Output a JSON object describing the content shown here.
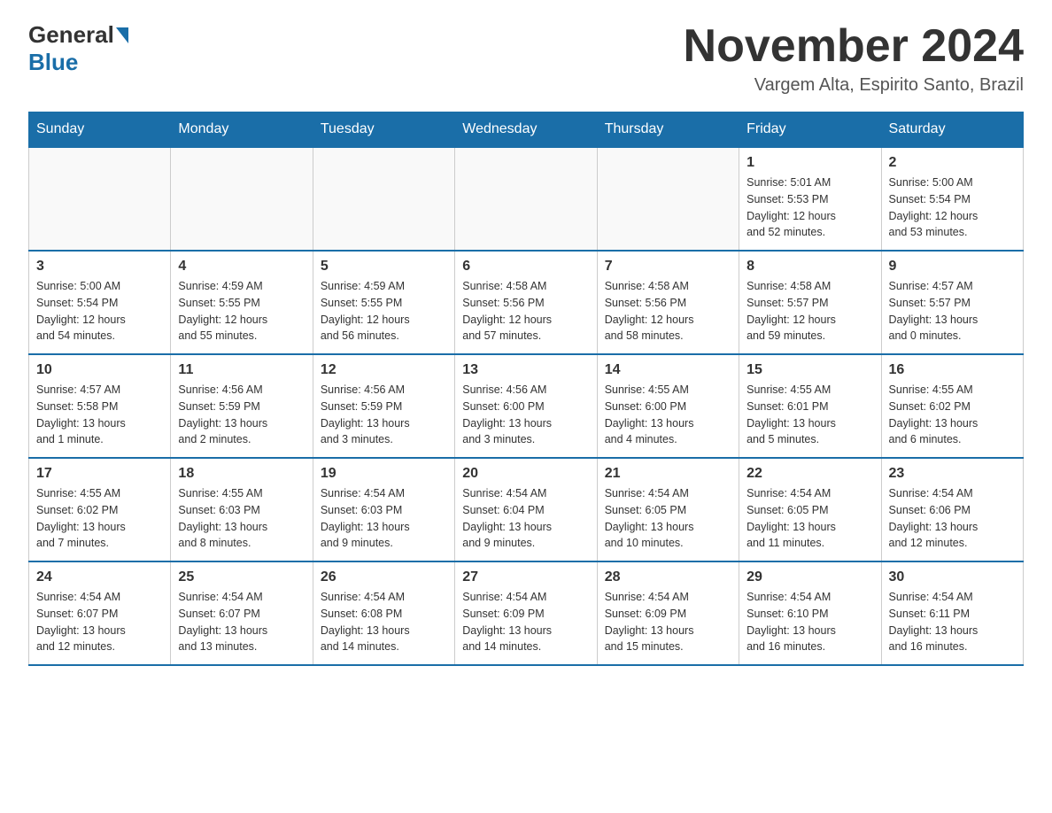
{
  "logo": {
    "general": "General",
    "blue": "Blue"
  },
  "header": {
    "month_year": "November 2024",
    "location": "Vargem Alta, Espirito Santo, Brazil"
  },
  "weekdays": [
    "Sunday",
    "Monday",
    "Tuesday",
    "Wednesday",
    "Thursday",
    "Friday",
    "Saturday"
  ],
  "weeks": [
    [
      {
        "day": "",
        "info": ""
      },
      {
        "day": "",
        "info": ""
      },
      {
        "day": "",
        "info": ""
      },
      {
        "day": "",
        "info": ""
      },
      {
        "day": "",
        "info": ""
      },
      {
        "day": "1",
        "info": "Sunrise: 5:01 AM\nSunset: 5:53 PM\nDaylight: 12 hours\nand 52 minutes."
      },
      {
        "day": "2",
        "info": "Sunrise: 5:00 AM\nSunset: 5:54 PM\nDaylight: 12 hours\nand 53 minutes."
      }
    ],
    [
      {
        "day": "3",
        "info": "Sunrise: 5:00 AM\nSunset: 5:54 PM\nDaylight: 12 hours\nand 54 minutes."
      },
      {
        "day": "4",
        "info": "Sunrise: 4:59 AM\nSunset: 5:55 PM\nDaylight: 12 hours\nand 55 minutes."
      },
      {
        "day": "5",
        "info": "Sunrise: 4:59 AM\nSunset: 5:55 PM\nDaylight: 12 hours\nand 56 minutes."
      },
      {
        "day": "6",
        "info": "Sunrise: 4:58 AM\nSunset: 5:56 PM\nDaylight: 12 hours\nand 57 minutes."
      },
      {
        "day": "7",
        "info": "Sunrise: 4:58 AM\nSunset: 5:56 PM\nDaylight: 12 hours\nand 58 minutes."
      },
      {
        "day": "8",
        "info": "Sunrise: 4:58 AM\nSunset: 5:57 PM\nDaylight: 12 hours\nand 59 minutes."
      },
      {
        "day": "9",
        "info": "Sunrise: 4:57 AM\nSunset: 5:57 PM\nDaylight: 13 hours\nand 0 minutes."
      }
    ],
    [
      {
        "day": "10",
        "info": "Sunrise: 4:57 AM\nSunset: 5:58 PM\nDaylight: 13 hours\nand 1 minute."
      },
      {
        "day": "11",
        "info": "Sunrise: 4:56 AM\nSunset: 5:59 PM\nDaylight: 13 hours\nand 2 minutes."
      },
      {
        "day": "12",
        "info": "Sunrise: 4:56 AM\nSunset: 5:59 PM\nDaylight: 13 hours\nand 3 minutes."
      },
      {
        "day": "13",
        "info": "Sunrise: 4:56 AM\nSunset: 6:00 PM\nDaylight: 13 hours\nand 3 minutes."
      },
      {
        "day": "14",
        "info": "Sunrise: 4:55 AM\nSunset: 6:00 PM\nDaylight: 13 hours\nand 4 minutes."
      },
      {
        "day": "15",
        "info": "Sunrise: 4:55 AM\nSunset: 6:01 PM\nDaylight: 13 hours\nand 5 minutes."
      },
      {
        "day": "16",
        "info": "Sunrise: 4:55 AM\nSunset: 6:02 PM\nDaylight: 13 hours\nand 6 minutes."
      }
    ],
    [
      {
        "day": "17",
        "info": "Sunrise: 4:55 AM\nSunset: 6:02 PM\nDaylight: 13 hours\nand 7 minutes."
      },
      {
        "day": "18",
        "info": "Sunrise: 4:55 AM\nSunset: 6:03 PM\nDaylight: 13 hours\nand 8 minutes."
      },
      {
        "day": "19",
        "info": "Sunrise: 4:54 AM\nSunset: 6:03 PM\nDaylight: 13 hours\nand 9 minutes."
      },
      {
        "day": "20",
        "info": "Sunrise: 4:54 AM\nSunset: 6:04 PM\nDaylight: 13 hours\nand 9 minutes."
      },
      {
        "day": "21",
        "info": "Sunrise: 4:54 AM\nSunset: 6:05 PM\nDaylight: 13 hours\nand 10 minutes."
      },
      {
        "day": "22",
        "info": "Sunrise: 4:54 AM\nSunset: 6:05 PM\nDaylight: 13 hours\nand 11 minutes."
      },
      {
        "day": "23",
        "info": "Sunrise: 4:54 AM\nSunset: 6:06 PM\nDaylight: 13 hours\nand 12 minutes."
      }
    ],
    [
      {
        "day": "24",
        "info": "Sunrise: 4:54 AM\nSunset: 6:07 PM\nDaylight: 13 hours\nand 12 minutes."
      },
      {
        "day": "25",
        "info": "Sunrise: 4:54 AM\nSunset: 6:07 PM\nDaylight: 13 hours\nand 13 minutes."
      },
      {
        "day": "26",
        "info": "Sunrise: 4:54 AM\nSunset: 6:08 PM\nDaylight: 13 hours\nand 14 minutes."
      },
      {
        "day": "27",
        "info": "Sunrise: 4:54 AM\nSunset: 6:09 PM\nDaylight: 13 hours\nand 14 minutes."
      },
      {
        "day": "28",
        "info": "Sunrise: 4:54 AM\nSunset: 6:09 PM\nDaylight: 13 hours\nand 15 minutes."
      },
      {
        "day": "29",
        "info": "Sunrise: 4:54 AM\nSunset: 6:10 PM\nDaylight: 13 hours\nand 16 minutes."
      },
      {
        "day": "30",
        "info": "Sunrise: 4:54 AM\nSunset: 6:11 PM\nDaylight: 13 hours\nand 16 minutes."
      }
    ]
  ]
}
